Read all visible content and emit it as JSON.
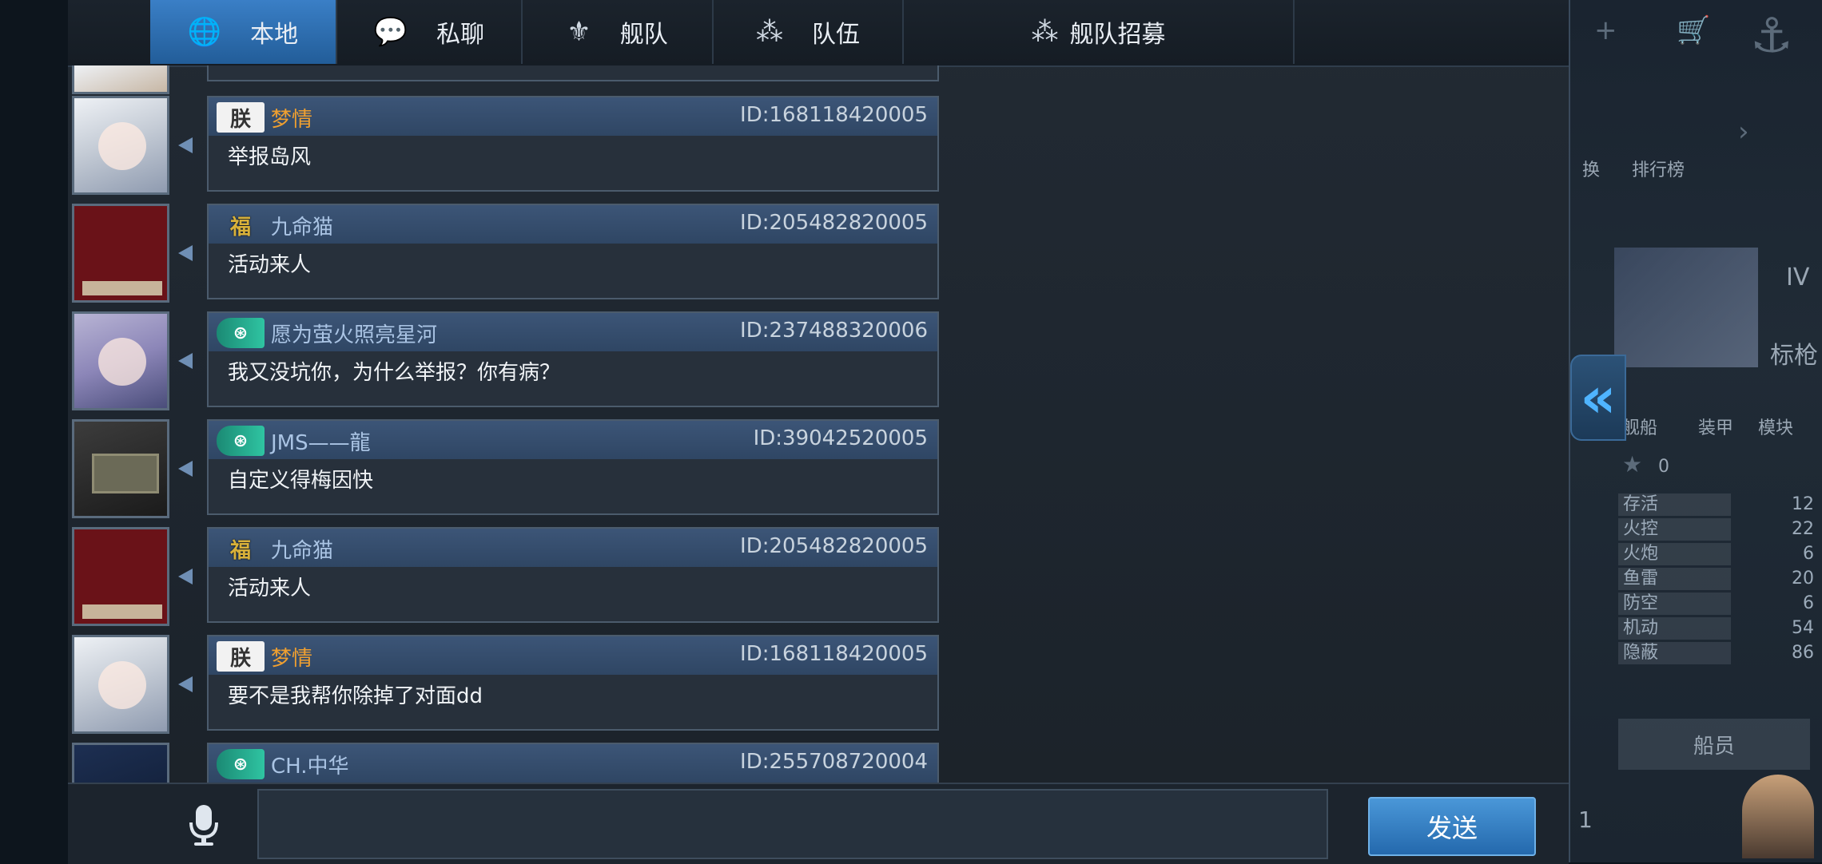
{
  "tabs": [
    {
      "label": "本地",
      "icon": "globe-icon",
      "glyph": "🌐",
      "active": true
    },
    {
      "label": "私聊",
      "icon": "chat-bubble-icon",
      "glyph": "💬",
      "active": false
    },
    {
      "label": "舰队",
      "icon": "fleet-emblem-icon",
      "glyph": "⚜",
      "active": false
    },
    {
      "label": "队伍",
      "icon": "team-icon",
      "glyph": "⁂",
      "active": false
    },
    {
      "label": "舰队招募",
      "icon": "recruit-icon",
      "glyph": "⁂",
      "active": false
    }
  ],
  "messages": [
    {
      "name": "梦情",
      "id": "ID:168118420005",
      "text": "举报岛风",
      "badge": "朕",
      "badge_style": "white",
      "name_color": "orange",
      "avatar": "anime"
    },
    {
      "name": "九命猫",
      "id": "ID:205482820005",
      "text": "活动来人",
      "badge": "福",
      "badge_style": "gold",
      "name_color": "blue",
      "avatar": "red"
    },
    {
      "name": "愿为萤火照亮星河",
      "id": "ID:237488320006",
      "text": "我又没坑你，为什么举报？你有病？",
      "badge": "⊛",
      "badge_style": "green",
      "name_color": "blue",
      "avatar": "purple"
    },
    {
      "name": "JMS——龍",
      "id": "ID:39042520005",
      "text": "自定义得梅因快",
      "badge": "⊛",
      "badge_style": "green",
      "name_color": "blue",
      "avatar": "stone"
    },
    {
      "name": "九命猫",
      "id": "ID:205482820005",
      "text": "活动来人",
      "badge": "福",
      "badge_style": "gold",
      "name_color": "blue",
      "avatar": "red"
    },
    {
      "name": "梦情",
      "id": "ID:168118420005",
      "text": "要不是我帮你除掉了对面dd",
      "badge": "朕",
      "badge_style": "white",
      "name_color": "orange",
      "avatar": "anime"
    },
    {
      "name": "CH.中华",
      "id": "ID:255708720004",
      "text": "",
      "badge": "⊛",
      "badge_style": "green",
      "name_color": "blue",
      "avatar": "navy"
    }
  ],
  "input": {
    "value": "",
    "placeholder": ""
  },
  "send_label": "发送",
  "collapse_glyph": "«",
  "background_ui": {
    "btn_labels": [
      "换",
      "排行榜"
    ],
    "roman": "IV",
    "ship_label": "标枪",
    "sub_tabs": [
      "舰船",
      "装甲",
      "模块"
    ],
    "star_count": "0",
    "stats": [
      {
        "name": "存活",
        "value": "12"
      },
      {
        "name": "火控",
        "value": "22"
      },
      {
        "name": "火炮",
        "value": "6"
      },
      {
        "name": "鱼雷",
        "value": "20"
      },
      {
        "name": "防空",
        "value": "6"
      },
      {
        "name": "机动",
        "value": "54"
      },
      {
        "name": "隐蔽",
        "value": "86"
      }
    ],
    "crew_button": "船员",
    "bottom_number": "1"
  }
}
